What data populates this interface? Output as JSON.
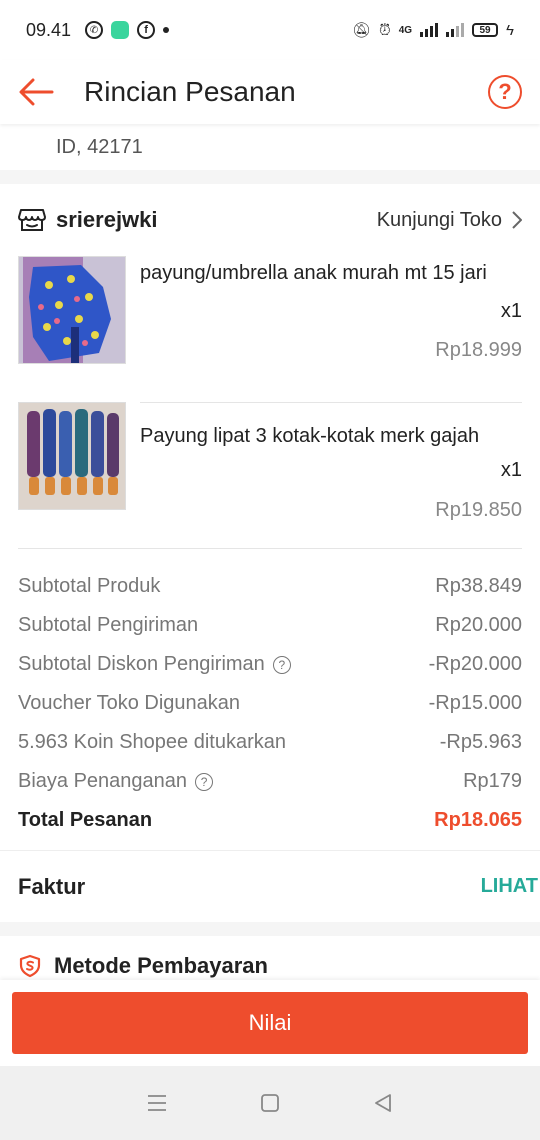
{
  "status_bar": {
    "time": "09.41",
    "network": "4G",
    "battery": "59"
  },
  "header": {
    "title": "Rincian Pesanan"
  },
  "address": {
    "tail_line": "ID, 42171"
  },
  "shop": {
    "name": "srierejwki",
    "visit_label": "Kunjungi Toko"
  },
  "products": [
    {
      "name": "payung/umbrella  anak murah mt 15 jari",
      "qty": "x1",
      "price": "Rp18.999"
    },
    {
      "name": "Payung lipat 3 kotak-kotak merk gajah",
      "qty": "x1",
      "price": "Rp19.850"
    }
  ],
  "totals": {
    "rows": [
      {
        "label": "Subtotal Produk",
        "value": "Rp38.849"
      },
      {
        "label": "Subtotal Pengiriman",
        "value": "Rp20.000"
      },
      {
        "label": "Subtotal Diskon Pengiriman",
        "value": "-Rp20.000"
      },
      {
        "label": "Voucher Toko Digunakan",
        "value": "-Rp15.000"
      },
      {
        "label": "5.963 Koin Shopee ditukarkan",
        "value": "-Rp5.963"
      },
      {
        "label": "Biaya Penanganan",
        "value": "Rp179"
      }
    ],
    "total_label": "Total Pesanan",
    "total_value": "Rp18.065"
  },
  "faktur": {
    "label": "Faktur",
    "link": "LIHAT"
  },
  "payment": {
    "label": "Metode Pembayaran"
  },
  "actions": {
    "rate_label": "Nilai"
  },
  "colors": {
    "brand": "#ee4d2d",
    "link": "#26aa99"
  }
}
